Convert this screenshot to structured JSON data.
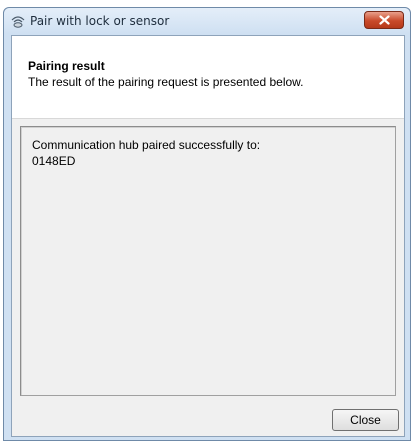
{
  "window": {
    "title": "Pair with lock or sensor",
    "close_icon": "close-icon",
    "app_icon": "wireless-sensor-icon"
  },
  "header": {
    "title": "Pairing result",
    "subtitle": "The result of the pairing request is presented below."
  },
  "result": {
    "message": "Communication hub paired successfully to:",
    "device_id": "0148ED"
  },
  "buttons": {
    "close_label": "Close"
  },
  "colors": {
    "titlebar": "#cfe0f2",
    "close_button": "#c94a2a",
    "dialog_background": "#f0f0f0",
    "header_background": "#ffffff"
  }
}
